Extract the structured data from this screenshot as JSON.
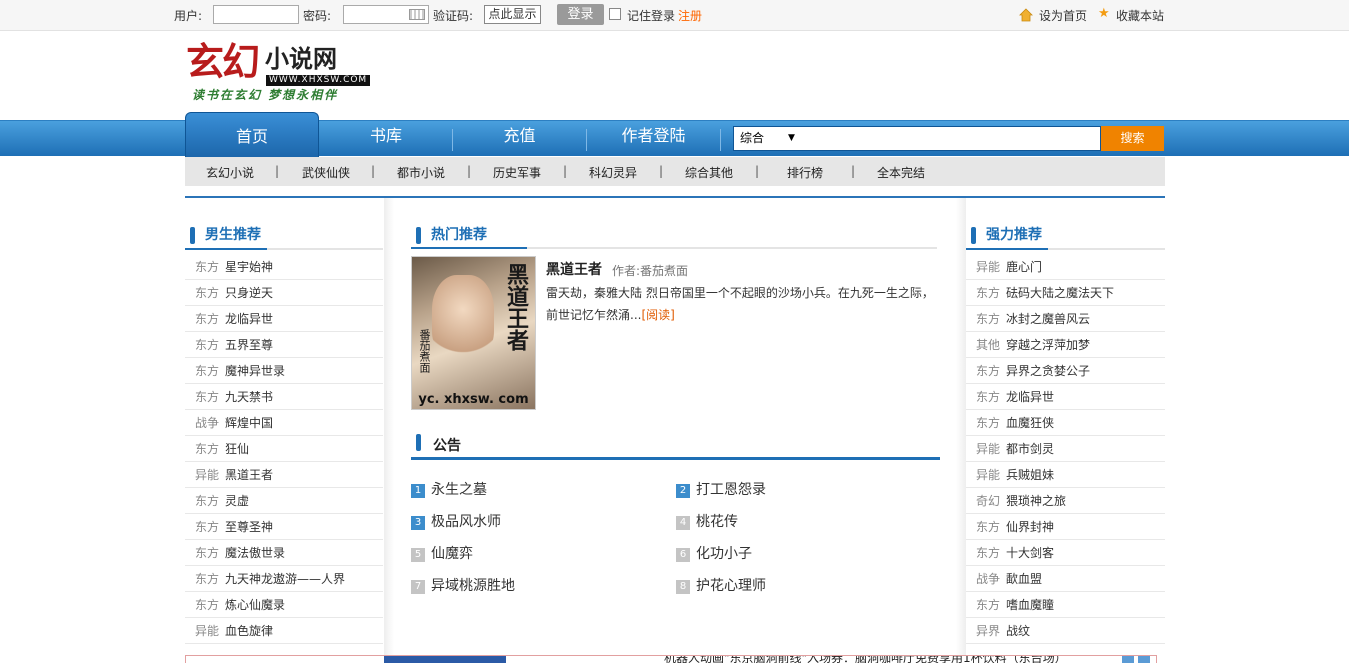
{
  "topbar": {
    "user_label": "用户:",
    "password_label": "密码:",
    "captcha_label": "验证码:",
    "captcha_button": "点此显示",
    "login_button": "登录",
    "remember_label": "记住登录",
    "register_link": "注册",
    "set_home": "设为首页",
    "add_favorite": "收藏本站"
  },
  "logo": {
    "main": "玄幻",
    "sub": "小说网",
    "domain": "WWW.XHXSW.COM",
    "slogan": "读书在玄幻 梦想永相伴"
  },
  "nav": {
    "items": [
      "首页",
      "书库",
      "充值",
      "作者登陆"
    ],
    "active": "首页"
  },
  "search": {
    "category": "综合",
    "button": "搜索"
  },
  "subnav": [
    "玄幻小说",
    "武侠仙侠",
    "都市小说",
    "历史军事",
    "科幻灵异",
    "综合其他",
    "排行榜",
    "全本完结"
  ],
  "left_panel": {
    "title": "男生推荐",
    "items": [
      {
        "cat": "东方",
        "name": "星宇始神"
      },
      {
        "cat": "东方",
        "name": "只身逆天"
      },
      {
        "cat": "东方",
        "name": "龙临异世"
      },
      {
        "cat": "东方",
        "name": "五界至尊"
      },
      {
        "cat": "东方",
        "name": "魔神异世录"
      },
      {
        "cat": "东方",
        "name": "九天禁书"
      },
      {
        "cat": "战争",
        "name": "辉煌中国"
      },
      {
        "cat": "东方",
        "name": "狂仙"
      },
      {
        "cat": "异能",
        "name": "黑道王者"
      },
      {
        "cat": "东方",
        "name": "灵虚"
      },
      {
        "cat": "东方",
        "name": "至尊圣神"
      },
      {
        "cat": "东方",
        "name": "魔法傲世录"
      },
      {
        "cat": "东方",
        "name": "九天神龙遨游——人界"
      },
      {
        "cat": "东方",
        "name": "炼心仙魔录"
      },
      {
        "cat": "异能",
        "name": "血色旋律"
      }
    ]
  },
  "hot": {
    "title": "热门推荐",
    "book_title": "黑道王者",
    "author_label": "作者:番茄煮面",
    "cover_title": "黑道王者",
    "cover_author": "番茄煮面",
    "cover_url": "yc. xhxsw. com",
    "description": "雷天劫，秦雅大陆 烈日帝国里一个不起眼的沙场小兵。在九死一生之际，前世记忆乍然涌...",
    "read_link": "[阅读]"
  },
  "notice": {
    "title": "公告",
    "items": [
      {
        "num": "1",
        "name": "永生之墓"
      },
      {
        "num": "2",
        "name": "打工恩怨录"
      },
      {
        "num": "3",
        "name": "极品风水师"
      },
      {
        "num": "4",
        "name": "桃花传"
      },
      {
        "num": "5",
        "name": "仙魔弈"
      },
      {
        "num": "6",
        "name": "化功小子"
      },
      {
        "num": "7",
        "name": "异域桃源胜地"
      },
      {
        "num": "8",
        "name": "护花心理师"
      }
    ]
  },
  "right_panel": {
    "title": "强力推荐",
    "items": [
      {
        "cat": "异能",
        "name": "鹿心门"
      },
      {
        "cat": "东方",
        "name": "砝码大陆之魔法天下"
      },
      {
        "cat": "东方",
        "name": "冰封之魔兽风云"
      },
      {
        "cat": "其他",
        "name": "穿越之浮萍加梦"
      },
      {
        "cat": "东方",
        "name": "异界之贪婪公子"
      },
      {
        "cat": "东方",
        "name": "龙临异世"
      },
      {
        "cat": "东方",
        "name": "血魔狂侠"
      },
      {
        "cat": "异能",
        "name": "都市剑灵"
      },
      {
        "cat": "异能",
        "name": "兵贼姐妹"
      },
      {
        "cat": "奇幻",
        "name": "猥琐神之旅"
      },
      {
        "cat": "东方",
        "name": "仙界封神"
      },
      {
        "cat": "东方",
        "name": "十大剑客"
      },
      {
        "cat": "战争",
        "name": "歃血盟"
      },
      {
        "cat": "东方",
        "name": "嗜血魔瞳"
      },
      {
        "cat": "异界",
        "name": "战纹"
      }
    ]
  },
  "ad": {
    "text": "机器人动画\"东京脑洞前线\"入场券：脑洞咖啡厅免费享用1杯饮料（东台场）"
  }
}
